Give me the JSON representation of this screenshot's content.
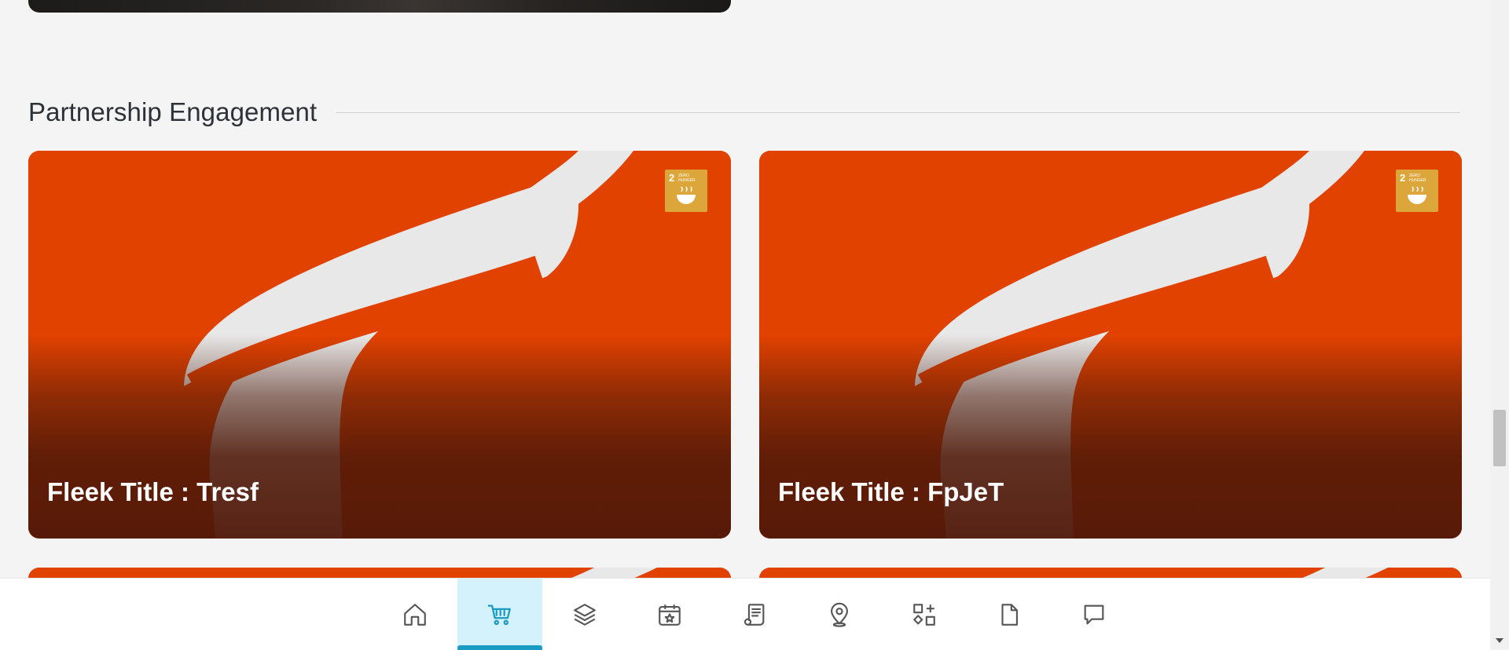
{
  "section": {
    "title": "Partnership Engagement"
  },
  "cards": [
    {
      "title": "Fleek Title : Tresf",
      "badge": {
        "number": "2",
        "text": "ZERO HUNGER",
        "icon": "bowl-icon"
      }
    },
    {
      "title": "Fleek Title : FpJeT",
      "badge": {
        "number": "2",
        "text": "ZERO HUNGER",
        "icon": "bowl-icon"
      }
    }
  ],
  "colors": {
    "accent": "#1a9bc4",
    "active_tab_bg": "#d4f2fc",
    "card_orange": "#e24200",
    "badge_gold": "#dda63a"
  },
  "bottom_nav": {
    "active": "cart",
    "items": [
      {
        "icon": "home-icon"
      },
      {
        "icon": "cart-icon"
      },
      {
        "icon": "layers-icon"
      },
      {
        "icon": "calendar-star-icon"
      },
      {
        "icon": "document-list-icon"
      },
      {
        "icon": "location-pin-icon"
      },
      {
        "icon": "apps-add-icon"
      },
      {
        "icon": "file-icon"
      },
      {
        "icon": "chat-icon"
      }
    ]
  }
}
